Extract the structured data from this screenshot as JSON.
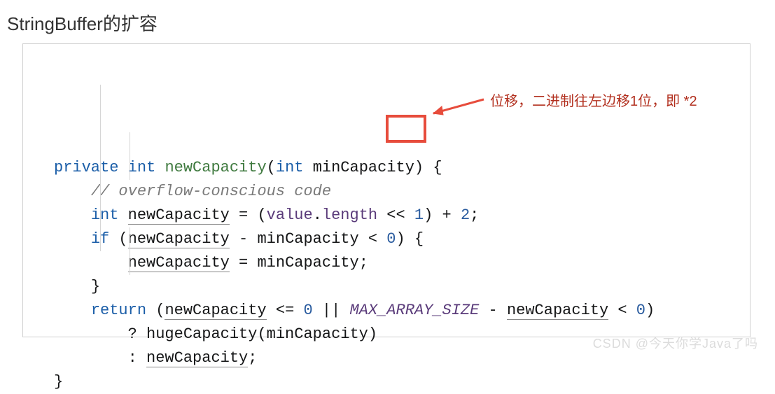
{
  "title": "StringBuffer的扩容",
  "annotation": "位移，二进制往左边移1位，即 *2",
  "watermark": "CSDN @今天你学Java了吗",
  "code": {
    "l1": {
      "kw1": "private",
      "kw2": "int",
      "fn": "newCapacity",
      "kw3": "int",
      "arg": "minCapacity",
      "end": ") {"
    },
    "l2": {
      "cm": "// overflow-conscious code"
    },
    "l3": {
      "kw": "int",
      "var": "newCapacity",
      "eq": " = (",
      "id1": "value",
      "dot": ".",
      "id2": "length",
      "op": " << ",
      "n1": "1",
      "end1": ") + ",
      "n2": "2",
      "end2": ";"
    },
    "l4": {
      "kw": "if",
      "open": " (",
      "v1": "newCapacity",
      "mid": " - minCapacity < ",
      "n": "0",
      "end": ") {"
    },
    "l5": {
      "v": "newCapacity",
      "rest": " = minCapacity;"
    },
    "l6": {
      "brace": "}"
    },
    "l7": {
      "kw": "return",
      "open": " (",
      "v1": "newCapacity",
      "mid1": " <= ",
      "n1": "0",
      "or": " || ",
      "c": "MAX_ARRAY_SIZE",
      "mid2": " - ",
      "v2": "newCapacity",
      "mid3": " < ",
      "n2": "0",
      "end": ")"
    },
    "l8": {
      "q": "? hugeCapacity(minCapacity)"
    },
    "l9": {
      "c": ":",
      "sp": " ",
      "v": "newCapacity",
      "end": ";"
    },
    "l10": {
      "brace": "}"
    }
  }
}
